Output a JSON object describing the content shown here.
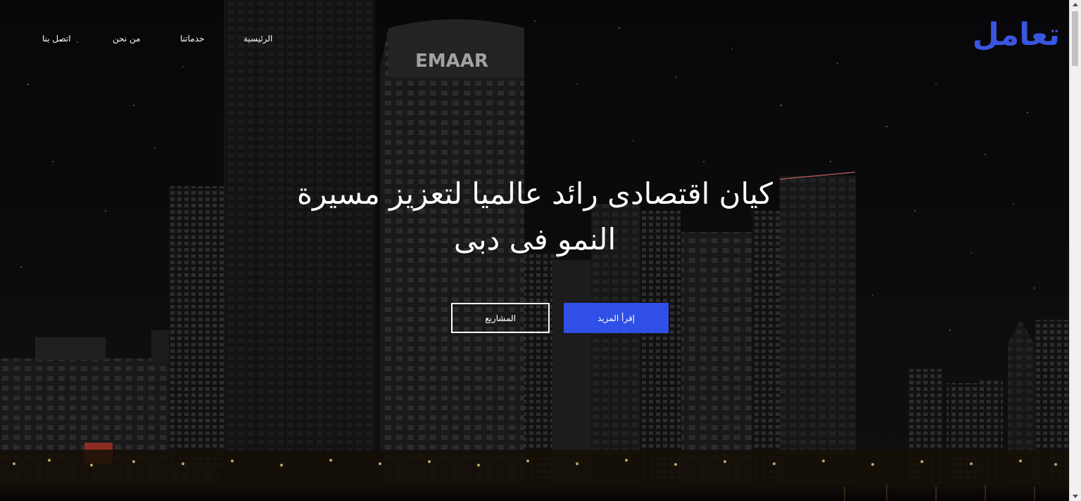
{
  "brand": {
    "logo_text": "تعامل",
    "accent_color": "#3a55e0"
  },
  "nav": {
    "items": [
      {
        "label": "الرئيسية"
      },
      {
        "label": "خدماتنا"
      },
      {
        "label": "من نحن"
      },
      {
        "label": "اتصل بنا"
      }
    ]
  },
  "hero": {
    "title_line1": "كيان اقتصادى رائد عالميا لتعزيز مسيرة",
    "title_line2": "النمو فى دبى",
    "background_image": "Dubai skyline at night with EMAAR tower",
    "building_sign": "EMAAR",
    "primary_button_label": "إقرأ المزيد",
    "secondary_button_label": "المشاريع",
    "primary_button_color": "#2f4fe6"
  }
}
